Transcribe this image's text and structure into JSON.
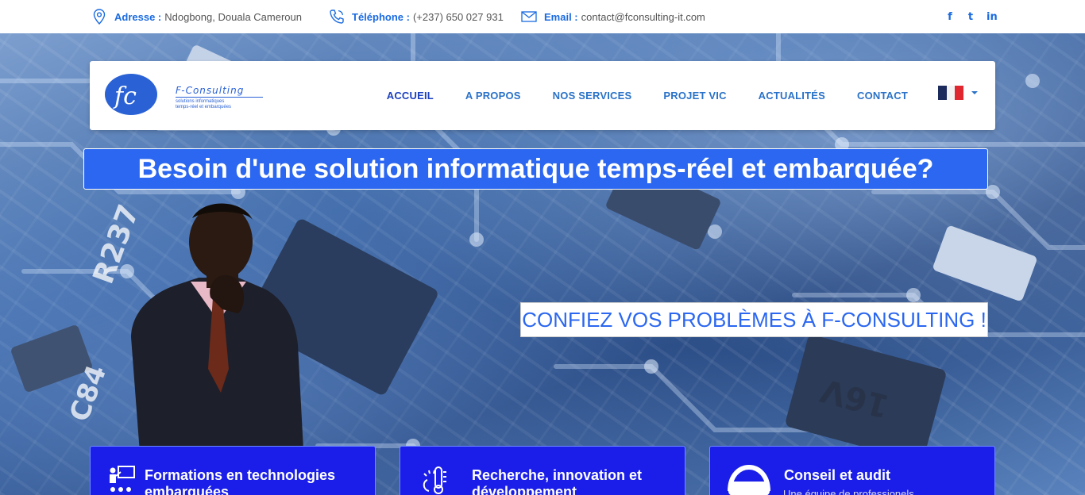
{
  "topbar": {
    "address_label": "Adresse :",
    "address_value": "Ndogbong, Douala Cameroun",
    "phone_label": "Téléphone :",
    "phone_value": "(+237) 650 027 931",
    "email_label": "Email :",
    "email_value": "contact@fconsulting-it.com",
    "social": [
      "f",
      "t",
      "in"
    ]
  },
  "logo": {
    "name": "F-Consulting",
    "tagline_1": "solutions informatiques",
    "tagline_2": "temps-réel et embarquées"
  },
  "nav": {
    "items": [
      "ACCUEIL",
      "A PROPOS",
      "NOS SERVICES",
      "PROJET VIC",
      "ACTUALITÉS",
      "CONTACT"
    ],
    "active": "ACCUEIL"
  },
  "hero": {
    "headline": "Besoin d'une solution informatique temps-réel et embarquée?",
    "subline": "CONFIEZ VOS PROBLÈMES À F-CONSULTING !"
  },
  "cards": [
    {
      "title_1": "Formations en technologies",
      "title_2": "embarquées",
      "icon": "presentation-icon"
    },
    {
      "title_1": "Recherche, innovation et",
      "title_2": "développement",
      "icon": "thermometer-icon"
    },
    {
      "title_1": "Conseil et audit",
      "title_2": "Une équipe de professionels",
      "icon": "headset-icon"
    }
  ],
  "colors": {
    "accent": "#2b67f0",
    "card": "#1a1ee8",
    "nav": "#2a72c8"
  }
}
